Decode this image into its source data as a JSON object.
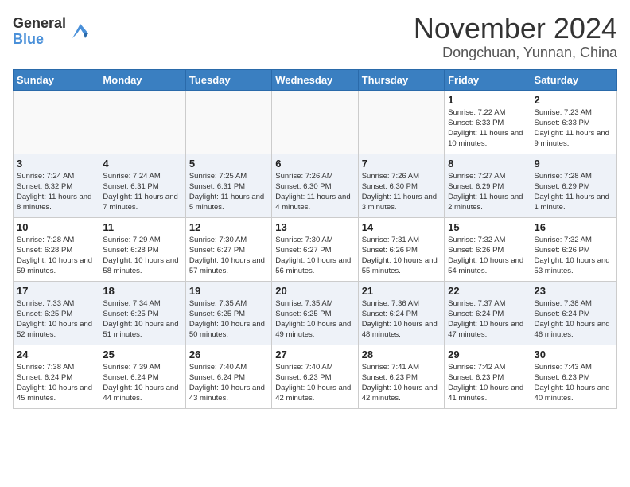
{
  "header": {
    "logo_general": "General",
    "logo_blue": "Blue",
    "month_title": "November 2024",
    "location": "Dongchuan, Yunnan, China"
  },
  "weekdays": [
    "Sunday",
    "Monday",
    "Tuesday",
    "Wednesday",
    "Thursday",
    "Friday",
    "Saturday"
  ],
  "weeks": [
    [
      {
        "day": "",
        "info": ""
      },
      {
        "day": "",
        "info": ""
      },
      {
        "day": "",
        "info": ""
      },
      {
        "day": "",
        "info": ""
      },
      {
        "day": "",
        "info": ""
      },
      {
        "day": "1",
        "info": "Sunrise: 7:22 AM\nSunset: 6:33 PM\nDaylight: 11 hours and 10 minutes."
      },
      {
        "day": "2",
        "info": "Sunrise: 7:23 AM\nSunset: 6:33 PM\nDaylight: 11 hours and 9 minutes."
      }
    ],
    [
      {
        "day": "3",
        "info": "Sunrise: 7:24 AM\nSunset: 6:32 PM\nDaylight: 11 hours and 8 minutes."
      },
      {
        "day": "4",
        "info": "Sunrise: 7:24 AM\nSunset: 6:31 PM\nDaylight: 11 hours and 7 minutes."
      },
      {
        "day": "5",
        "info": "Sunrise: 7:25 AM\nSunset: 6:31 PM\nDaylight: 11 hours and 5 minutes."
      },
      {
        "day": "6",
        "info": "Sunrise: 7:26 AM\nSunset: 6:30 PM\nDaylight: 11 hours and 4 minutes."
      },
      {
        "day": "7",
        "info": "Sunrise: 7:26 AM\nSunset: 6:30 PM\nDaylight: 11 hours and 3 minutes."
      },
      {
        "day": "8",
        "info": "Sunrise: 7:27 AM\nSunset: 6:29 PM\nDaylight: 11 hours and 2 minutes."
      },
      {
        "day": "9",
        "info": "Sunrise: 7:28 AM\nSunset: 6:29 PM\nDaylight: 11 hours and 1 minute."
      }
    ],
    [
      {
        "day": "10",
        "info": "Sunrise: 7:28 AM\nSunset: 6:28 PM\nDaylight: 10 hours and 59 minutes."
      },
      {
        "day": "11",
        "info": "Sunrise: 7:29 AM\nSunset: 6:28 PM\nDaylight: 10 hours and 58 minutes."
      },
      {
        "day": "12",
        "info": "Sunrise: 7:30 AM\nSunset: 6:27 PM\nDaylight: 10 hours and 57 minutes."
      },
      {
        "day": "13",
        "info": "Sunrise: 7:30 AM\nSunset: 6:27 PM\nDaylight: 10 hours and 56 minutes."
      },
      {
        "day": "14",
        "info": "Sunrise: 7:31 AM\nSunset: 6:26 PM\nDaylight: 10 hours and 55 minutes."
      },
      {
        "day": "15",
        "info": "Sunrise: 7:32 AM\nSunset: 6:26 PM\nDaylight: 10 hours and 54 minutes."
      },
      {
        "day": "16",
        "info": "Sunrise: 7:32 AM\nSunset: 6:26 PM\nDaylight: 10 hours and 53 minutes."
      }
    ],
    [
      {
        "day": "17",
        "info": "Sunrise: 7:33 AM\nSunset: 6:25 PM\nDaylight: 10 hours and 52 minutes."
      },
      {
        "day": "18",
        "info": "Sunrise: 7:34 AM\nSunset: 6:25 PM\nDaylight: 10 hours and 51 minutes."
      },
      {
        "day": "19",
        "info": "Sunrise: 7:35 AM\nSunset: 6:25 PM\nDaylight: 10 hours and 50 minutes."
      },
      {
        "day": "20",
        "info": "Sunrise: 7:35 AM\nSunset: 6:25 PM\nDaylight: 10 hours and 49 minutes."
      },
      {
        "day": "21",
        "info": "Sunrise: 7:36 AM\nSunset: 6:24 PM\nDaylight: 10 hours and 48 minutes."
      },
      {
        "day": "22",
        "info": "Sunrise: 7:37 AM\nSunset: 6:24 PM\nDaylight: 10 hours and 47 minutes."
      },
      {
        "day": "23",
        "info": "Sunrise: 7:38 AM\nSunset: 6:24 PM\nDaylight: 10 hours and 46 minutes."
      }
    ],
    [
      {
        "day": "24",
        "info": "Sunrise: 7:38 AM\nSunset: 6:24 PM\nDaylight: 10 hours and 45 minutes."
      },
      {
        "day": "25",
        "info": "Sunrise: 7:39 AM\nSunset: 6:24 PM\nDaylight: 10 hours and 44 minutes."
      },
      {
        "day": "26",
        "info": "Sunrise: 7:40 AM\nSunset: 6:24 PM\nDaylight: 10 hours and 43 minutes."
      },
      {
        "day": "27",
        "info": "Sunrise: 7:40 AM\nSunset: 6:23 PM\nDaylight: 10 hours and 42 minutes."
      },
      {
        "day": "28",
        "info": "Sunrise: 7:41 AM\nSunset: 6:23 PM\nDaylight: 10 hours and 42 minutes."
      },
      {
        "day": "29",
        "info": "Sunrise: 7:42 AM\nSunset: 6:23 PM\nDaylight: 10 hours and 41 minutes."
      },
      {
        "day": "30",
        "info": "Sunrise: 7:43 AM\nSunset: 6:23 PM\nDaylight: 10 hours and 40 minutes."
      }
    ]
  ]
}
